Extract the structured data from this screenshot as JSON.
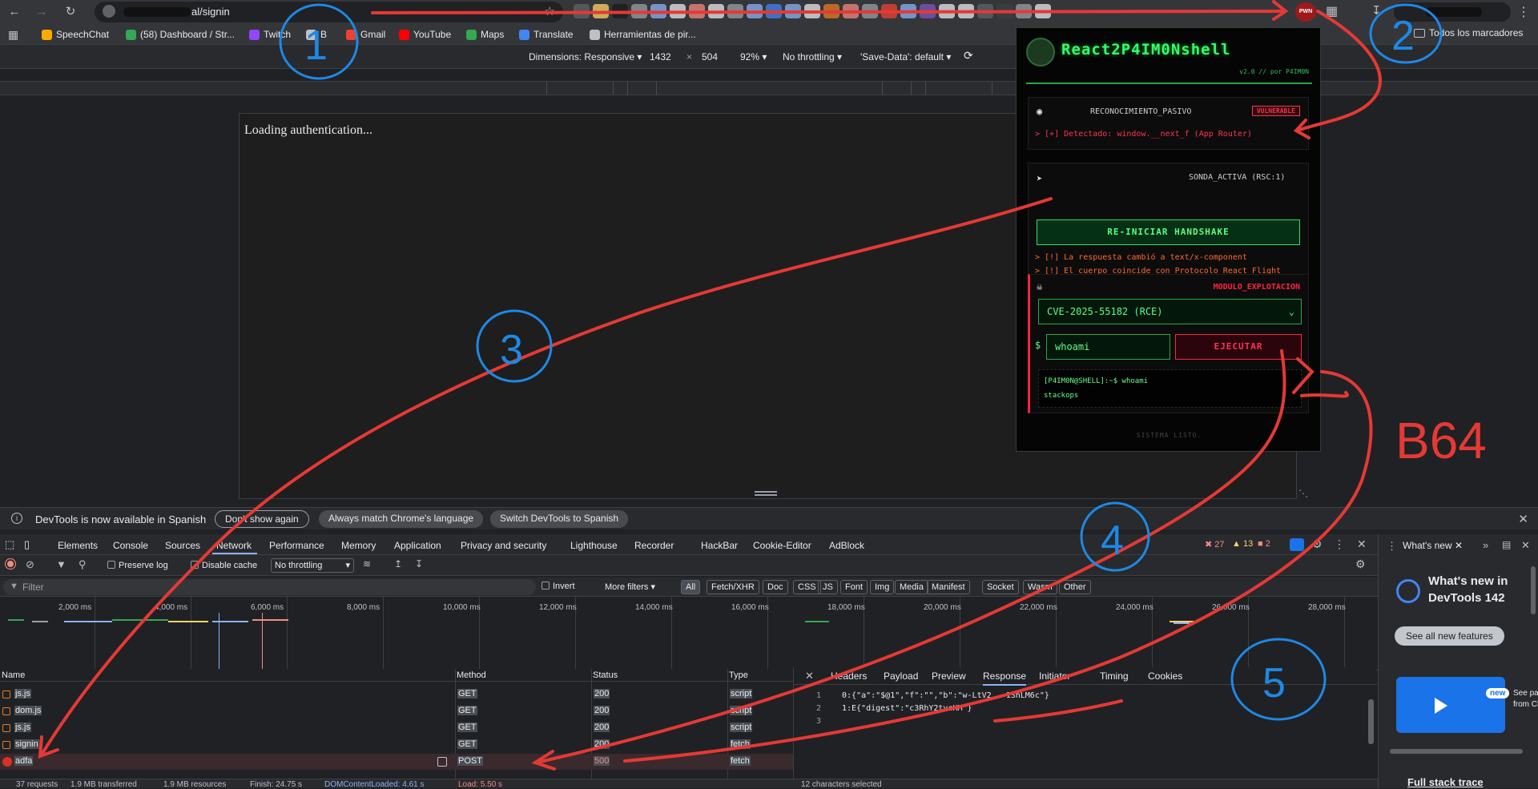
{
  "browser": {
    "url_suffix": "al/signin",
    "pwn_extension_label": "PWN",
    "bookmarks": [
      {
        "label": "SpeechChat",
        "color": "#f9ab00"
      },
      {
        "label": "(58) Dashboard / Str...",
        "color": "#34a853"
      },
      {
        "label": "Twitch",
        "color": "#9146ff"
      },
      {
        "label": "B",
        "color": "#bdc1c6"
      },
      {
        "label": "Gmail",
        "color": "#ea4335"
      },
      {
        "label": "YouTube",
        "color": "#ff0000"
      },
      {
        "label": "Maps",
        "color": "#34a853"
      },
      {
        "label": "Translate",
        "color": "#4285f4"
      },
      {
        "label": "Herramientas de pir...",
        "color": "#bdc1c6"
      }
    ],
    "all_bookmarks_label": "Todos los marcadores"
  },
  "device_toolbar": {
    "dimensions_label": "Dimensions: Responsive",
    "width": "1432",
    "times": "×",
    "height": "504",
    "zoom": "92%",
    "throttling": "No throttling",
    "save_data": "'Save-Data': default"
  },
  "page": {
    "loading_text": "Loading authentication..."
  },
  "extension": {
    "title": "React2P4IM0Nshell",
    "version": "v2.0 // por P4IM0N",
    "recon": {
      "title": "RECONOCIMIENTO_PASIVO",
      "badge": "VULNERABLE",
      "log": "> [+] Detectado: window.__next_f (App Router)"
    },
    "probe": {
      "title": "SONDA_ACTIVA (RSC:1)",
      "button": "RE-INICIAR HANDSHAKE",
      "log1": "> [!] La respuesta cambió a text/x-component",
      "log2": "> [!] El cuerpo coincide con Protocolo React Flight"
    },
    "exploit": {
      "title": "MODULO_EXPLOTACION",
      "cve_selected": "CVE-2025-55182 (RCE)",
      "prompt": "$",
      "command": "whoami",
      "execute_button": "EJECUTAR",
      "terminal_line1": "[P4IM0N@SHELL]:~$ whoami",
      "terminal_line2": "stackops"
    },
    "status": "SISTEMA LISTO."
  },
  "infobar": {
    "message": "DevTools is now available in Spanish",
    "btn_dont_show": "Don't show again",
    "btn_always_match": "Always match Chrome's language",
    "btn_switch": "Switch DevTools to Spanish"
  },
  "devtools": {
    "tabs": [
      "Elements",
      "Console",
      "Sources",
      "Network",
      "Performance",
      "Memory",
      "Application",
      "Privacy and security",
      "Lighthouse",
      "Recorder",
      "HackBar",
      "Cookie-Editor",
      "AdBlock"
    ],
    "errors": "27",
    "warnings": "13",
    "issues": "2",
    "toolbar": {
      "preserve_log": "Preserve log",
      "disable_cache": "Disable cache",
      "throttle": "No throttling"
    },
    "filter": {
      "placeholder": "Filter",
      "invert": "Invert",
      "more_filters": "More filters",
      "types": [
        "All",
        "Fetch/XHR",
        "Doc",
        "CSS",
        "JS",
        "Font",
        "Img",
        "Media",
        "Manifest",
        "Socket",
        "Wasm",
        "Other"
      ]
    },
    "timeline_labels": [
      "2,000 ms",
      "4,000 ms",
      "6,000 ms",
      "8,000 ms",
      "10,000 ms",
      "12,000 ms",
      "14,000 ms",
      "16,000 ms",
      "18,000 ms",
      "20,000 ms",
      "22,000 ms",
      "24,000 ms",
      "26,000 ms",
      "28,000 ms"
    ],
    "columns": [
      "Name",
      "Method",
      "Status",
      "Type"
    ],
    "rows": [
      {
        "name": "js.js",
        "method": "GET",
        "status": "200",
        "type": "script",
        "error": false
      },
      {
        "name": "dom.js",
        "method": "GET",
        "status": "200",
        "type": "script",
        "error": false
      },
      {
        "name": "js.js",
        "method": "GET",
        "status": "200",
        "type": "script",
        "error": false
      },
      {
        "name": "signin",
        "method": "GET",
        "status": "200",
        "type": "fetch",
        "error": false
      },
      {
        "name": "adfa",
        "method": "POST",
        "status": "500",
        "type": "fetch",
        "error": true
      }
    ],
    "detail_tabs": [
      "Headers",
      "Payload",
      "Preview",
      "Response",
      "Initiator",
      "Timing",
      "Cookies"
    ],
    "response_lines": [
      {
        "n": "1",
        "text": "0:{\"a\":\"$@1\",\"f\":\"\",\"b\":\"w-LtV2   1ShLM6c\"}"
      },
      {
        "n": "2",
        "text": "1:E{\"digest\":\"c3RhY2tvcHM\"}"
      },
      {
        "n": "3",
        "text": ""
      }
    ],
    "status_bar": {
      "requests": "37 requests",
      "transferred": "1.9 MB transferred",
      "resources": "1.9 MB resources",
      "finish": "Finish: 24.75 s",
      "dcl": "DOMContentLoaded: 4.61 s",
      "load": "Load: 5.50 s",
      "selected": "12 characters selected"
    },
    "whats_new": {
      "tab": "What's new",
      "title_line1": "What's new in",
      "title_line2": "DevTools 142",
      "button": "See all new features",
      "badge": "new",
      "see_line1": "See pas",
      "see_line2": "from Ch",
      "full_stack": "Full stack trace"
    }
  },
  "annotations": {
    "labels": [
      "1",
      "2",
      "3",
      "4",
      "5",
      "B64"
    ],
    "color": "#e53935",
    "circle_color": "#1e88e5"
  }
}
